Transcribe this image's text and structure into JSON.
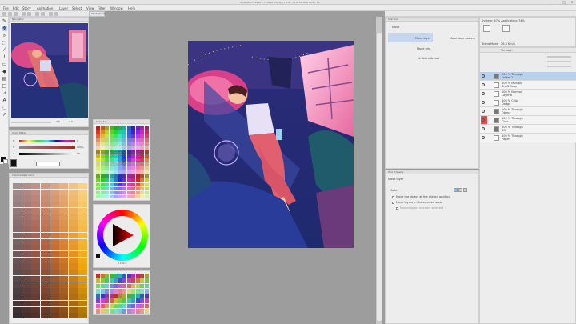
{
  "window": {
    "title": "Illustration* 4960 x 3508px 350dpi (7.6%) - CLIP STUDIO PAINT EX",
    "buttons": [
      "–",
      "□",
      "×"
    ]
  },
  "menu": [
    "File",
    "Edit",
    "Story",
    "Animation",
    "Layer",
    "Select",
    "View",
    "Filter",
    "Window",
    "Help"
  ],
  "canvas_tab": {
    "label": "Illustration*"
  },
  "toolbox": {
    "icons": [
      "pen-icon",
      "move-icon",
      "zoom-icon",
      "selection-icon",
      "eyedropper-icon",
      "brush-icon",
      "eraser-icon",
      "fill-icon",
      "gradient-icon",
      "figure-icon",
      "ruler-icon",
      "text-icon",
      "balloon-icon",
      "correct-line-icon"
    ]
  },
  "navigator": {
    "title": "Navigator",
    "zoom": "7.6",
    "angle": "0.0"
  },
  "color_slider": {
    "title": "Color Slider",
    "rows": [
      {
        "label": "H",
        "value": "0"
      },
      {
        "label": "S",
        "value": "100%"
      },
      {
        "label": "V",
        "value": "0%"
      }
    ]
  },
  "color_history": {
    "title": "Intermediate Color"
  },
  "color_set": {
    "title": "Color Set"
  },
  "color_wheel": {
    "title": "Color Wheel",
    "values": "0 100 0"
  },
  "subtool": {
    "title": "Sub Tool",
    "items": [
      {
        "label": "Move",
        "active": false
      },
      {
        "label": "Move layer",
        "active": true
      },
      {
        "label": "Move tone pattern",
        "active": false
      },
      {
        "label": "Move grid",
        "active": false
      }
    ],
    "add_label": "Add sub tool"
  },
  "tool_property": {
    "title": "Tool Property",
    "tool_name": "Move layer",
    "mode_label": "Mode",
    "options": [
      "Move the object at the clicked position",
      "Move layers in the selected area",
      "Moved layers become selected"
    ]
  },
  "system_info": {
    "title": "System: 67%  Application: 74%",
    "blend_label": "Blend Mode",
    "blend_value": "26.4 Km/h"
  },
  "layers": {
    "header": "Through",
    "rows": [
      {
        "line1": "100 % Through",
        "line2": "Folder 2",
        "type": "folder",
        "selected": true,
        "tag": ""
      },
      {
        "line1": "100 % Multiply",
        "line2": "Shaft Copy",
        "type": "layer",
        "selected": false,
        "tag": ""
      },
      {
        "line1": "100 % Normal",
        "line2": "Layer 6",
        "type": "layer",
        "selected": false,
        "tag": ""
      },
      {
        "line1": "100 % Color",
        "line2": "Dodge",
        "type": "layer",
        "selected": false,
        "tag": ""
      },
      {
        "line1": "100 % Through",
        "line2": "Object",
        "type": "folder",
        "selected": false,
        "tag": ""
      },
      {
        "line1": "100 % Through",
        "line2": "Char",
        "type": "folder",
        "selected": false,
        "tag": "#e05050"
      },
      {
        "line1": "100 % Through",
        "line2": "BG",
        "type": "folder",
        "selected": false,
        "tag": ""
      },
      {
        "line1": "100 % Through",
        "line2": "Paper",
        "type": "paper",
        "selected": false,
        "tag": ""
      }
    ]
  },
  "colors": {
    "accent": "#b9d0ec",
    "panel_bg": "#ededed",
    "workspace_bg": "#9d9d9d"
  }
}
